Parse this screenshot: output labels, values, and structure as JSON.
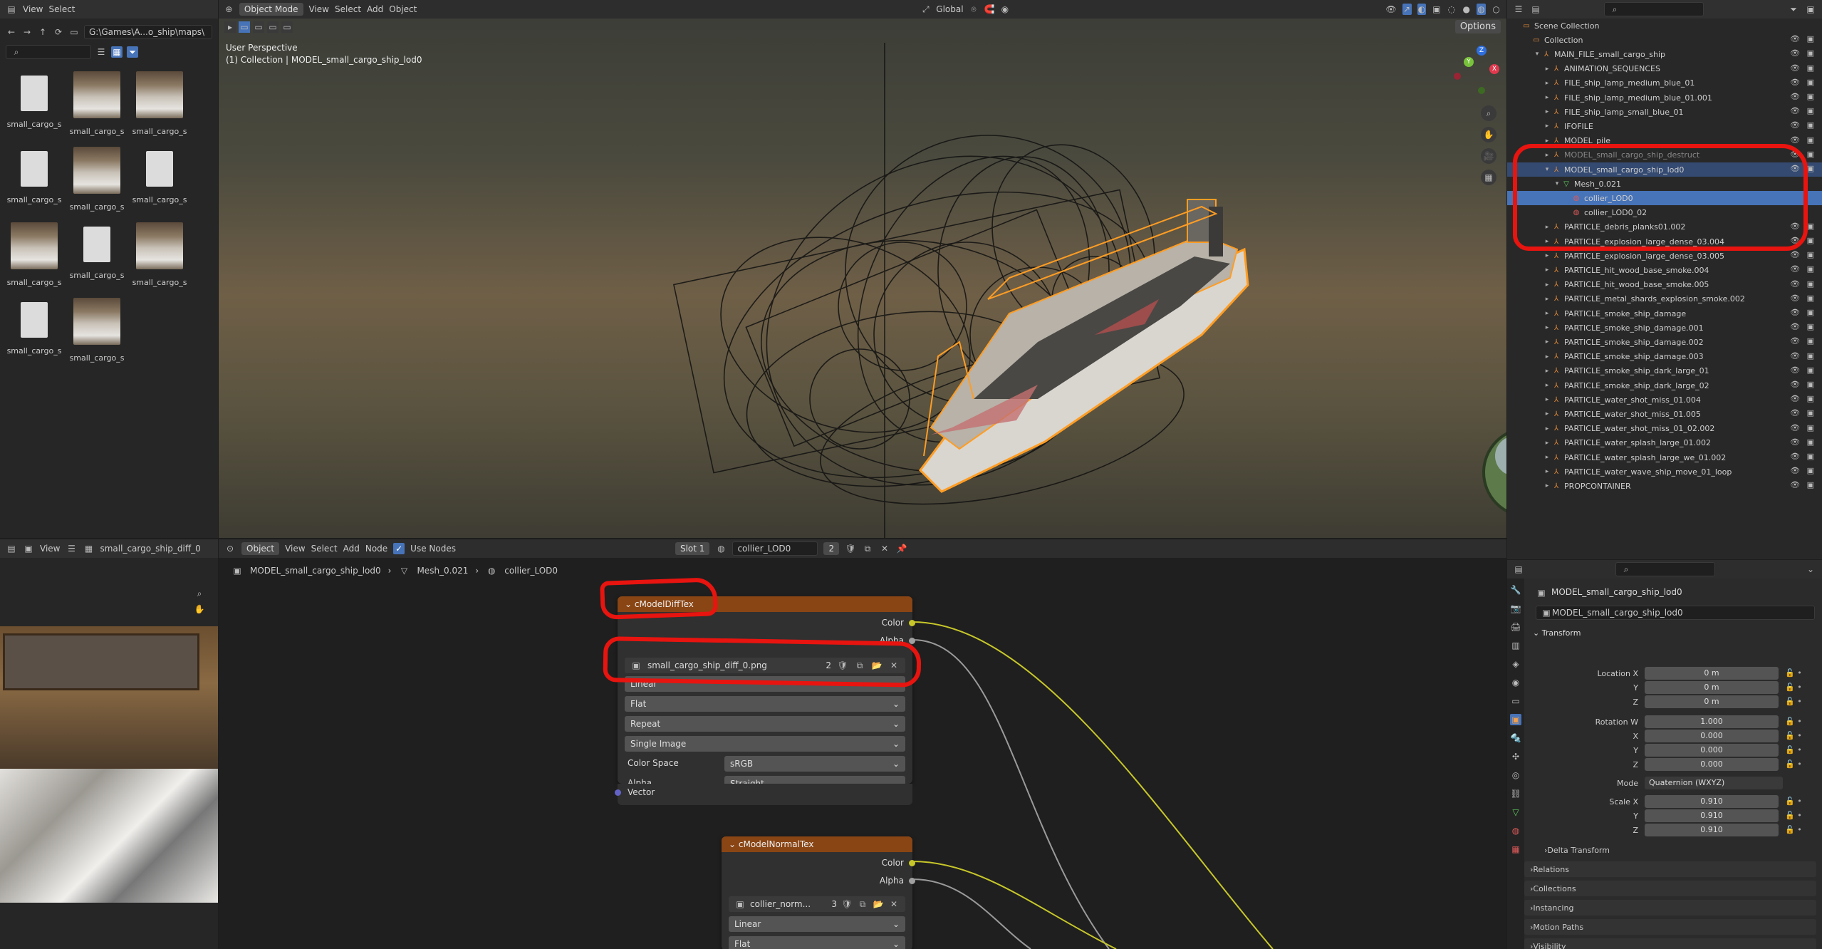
{
  "filebrowser": {
    "menu": [
      "View",
      "Select"
    ],
    "path": "G:\\Games\\A...o_ship\\maps\\",
    "files": [
      {
        "label": "small_cargo_s",
        "kind": "doc"
      },
      {
        "label": "small_cargo_s",
        "kind": "pic"
      },
      {
        "label": "small_cargo_s",
        "kind": "pic"
      },
      {
        "label": "small_cargo_s",
        "kind": "doc"
      },
      {
        "label": "small_cargo_s",
        "kind": "pic"
      },
      {
        "label": "small_cargo_s",
        "kind": "doc"
      },
      {
        "label": "small_cargo_s",
        "kind": "pic"
      },
      {
        "label": "small_cargo_s",
        "kind": "doc"
      },
      {
        "label": "small_cargo_s",
        "kind": "pic"
      },
      {
        "label": "small_cargo_s",
        "kind": "doc"
      },
      {
        "label": "small_cargo_s",
        "kind": "pic"
      }
    ]
  },
  "viewport": {
    "mode": "Object Mode",
    "menu": [
      "View",
      "Select",
      "Add",
      "Object"
    ],
    "orientation": "Global",
    "options_label": "Options",
    "overlay_title": "User Perspective",
    "overlay_subtitle": "(1) Collection | MODEL_small_cargo_ship_lod0",
    "gizmo_axes": [
      "Z",
      "X",
      "Y"
    ]
  },
  "outliner": {
    "rows": [
      {
        "label": "Scene Collection",
        "level": 0,
        "state": ""
      },
      {
        "label": "Collection",
        "level": 1,
        "state": ""
      },
      {
        "label": "MAIN_FILE_small_cargo_ship",
        "level": 2,
        "state": ""
      },
      {
        "label": "ANIMATION_SEQUENCES",
        "level": 3,
        "state": ""
      },
      {
        "label": "FILE_ship_lamp_medium_blue_01",
        "level": 3,
        "state": ""
      },
      {
        "label": "FILE_ship_lamp_medium_blue_01.001",
        "level": 3,
        "state": ""
      },
      {
        "label": "FILE_ship_lamp_small_blue_01",
        "level": 3,
        "state": ""
      },
      {
        "label": "IFOFILE",
        "level": 3,
        "state": ""
      },
      {
        "label": "MODEL_pile",
        "level": 3,
        "state": ""
      },
      {
        "label": "MODEL_small_cargo_ship_destruct",
        "level": 3,
        "state": "dim"
      },
      {
        "label": "MODEL_small_cargo_ship_lod0",
        "level": 3,
        "state": "sel"
      },
      {
        "label": "Mesh_0.021",
        "level": 4,
        "state": ""
      },
      {
        "label": "collier_LOD0",
        "level": 5,
        "state": "act"
      },
      {
        "label": "collier_LOD0_02",
        "level": 5,
        "state": ""
      },
      {
        "label": "PARTICLE_debris_planks01.002",
        "level": 3,
        "state": ""
      },
      {
        "label": "PARTICLE_explosion_large_dense_03.004",
        "level": 3,
        "state": ""
      },
      {
        "label": "PARTICLE_explosion_large_dense_03.005",
        "level": 3,
        "state": ""
      },
      {
        "label": "PARTICLE_hit_wood_base_smoke.004",
        "level": 3,
        "state": ""
      },
      {
        "label": "PARTICLE_hit_wood_base_smoke.005",
        "level": 3,
        "state": ""
      },
      {
        "label": "PARTICLE_metal_shards_explosion_smoke.002",
        "level": 3,
        "state": ""
      },
      {
        "label": "PARTICLE_smoke_ship_damage",
        "level": 3,
        "state": ""
      },
      {
        "label": "PARTICLE_smoke_ship_damage.001",
        "level": 3,
        "state": ""
      },
      {
        "label": "PARTICLE_smoke_ship_damage.002",
        "level": 3,
        "state": ""
      },
      {
        "label": "PARTICLE_smoke_ship_damage.003",
        "level": 3,
        "state": ""
      },
      {
        "label": "PARTICLE_smoke_ship_dark_large_01",
        "level": 3,
        "state": ""
      },
      {
        "label": "PARTICLE_smoke_ship_dark_large_02",
        "level": 3,
        "state": ""
      },
      {
        "label": "PARTICLE_water_shot_miss_01.004",
        "level": 3,
        "state": ""
      },
      {
        "label": "PARTICLE_water_shot_miss_01.005",
        "level": 3,
        "state": ""
      },
      {
        "label": "PARTICLE_water_shot_miss_01_02.002",
        "level": 3,
        "state": ""
      },
      {
        "label": "PARTICLE_water_splash_large_01.002",
        "level": 3,
        "state": ""
      },
      {
        "label": "PARTICLE_water_splash_large_we_01.002",
        "level": 3,
        "state": ""
      },
      {
        "label": "PARTICLE_water_wave_ship_move_01_loop",
        "level": 3,
        "state": ""
      },
      {
        "label": "PROPCONTAINER",
        "level": 3,
        "state": ""
      }
    ]
  },
  "imgeditor": {
    "view_label": "View",
    "image_name": "small_cargo_ship_diff_0"
  },
  "nodeeditor": {
    "object_label": "Object",
    "menu": [
      "View",
      "Select",
      "Add",
      "Node"
    ],
    "use_nodes_label": "Use Nodes",
    "slot": "Slot 1",
    "material": "collier_LOD0",
    "material_users": "2",
    "breadcrumb": [
      "MODEL_small_cargo_ship_lod0",
      "Mesh_0.021",
      "collier_LOD0"
    ],
    "diff_node": {
      "title": "cModelDiffTex",
      "out_color": "Color",
      "out_alpha": "Alpha",
      "image": "small_cargo_ship_diff_0.png",
      "image_users": "2",
      "interpolation": "Linear",
      "projection": "Flat",
      "extension": "Repeat",
      "source": "Single Image",
      "colorspace_label": "Color Space",
      "colorspace": "sRGB",
      "alpha_label": "Alpha",
      "alpha": "Straight",
      "in_vector": "Vector"
    },
    "normal_node": {
      "title": "cModelNormalTex",
      "out_color": "Color",
      "out_alpha": "Alpha",
      "image": "collier_norm...",
      "image_users": "3",
      "interpolation": "Linear",
      "projection": "Flat"
    }
  },
  "properties": {
    "object_name": "MODEL_small_cargo_ship_lod0",
    "object_field": "MODEL_small_cargo_ship_lod0",
    "transform_label": "Transform",
    "location_label": "Location X",
    "location": [
      "0 m",
      "0 m",
      "0 m"
    ],
    "rotation_label": "Rotation W",
    "rotation": [
      "1.000",
      "0.000",
      "0.000",
      "0.000"
    ],
    "mode_label": "Mode",
    "mode": "Quaternion (WXYZ)",
    "scale_label": "Scale X",
    "scale": [
      "0.910",
      "0.910",
      "0.910"
    ],
    "axis_y": "Y",
    "axis_z": "Z",
    "axis_x": "X",
    "panels": [
      "Delta Transform",
      "Relations",
      "Collections",
      "Instancing",
      "Motion Paths",
      "Visibility"
    ]
  },
  "colors": {
    "node_header": "#8a4514",
    "selection": "#344a71",
    "active": "#4773b8",
    "annotation": "#e8140f",
    "link_color": "#c7c72a",
    "link_alpha": "#9a9a9a"
  }
}
